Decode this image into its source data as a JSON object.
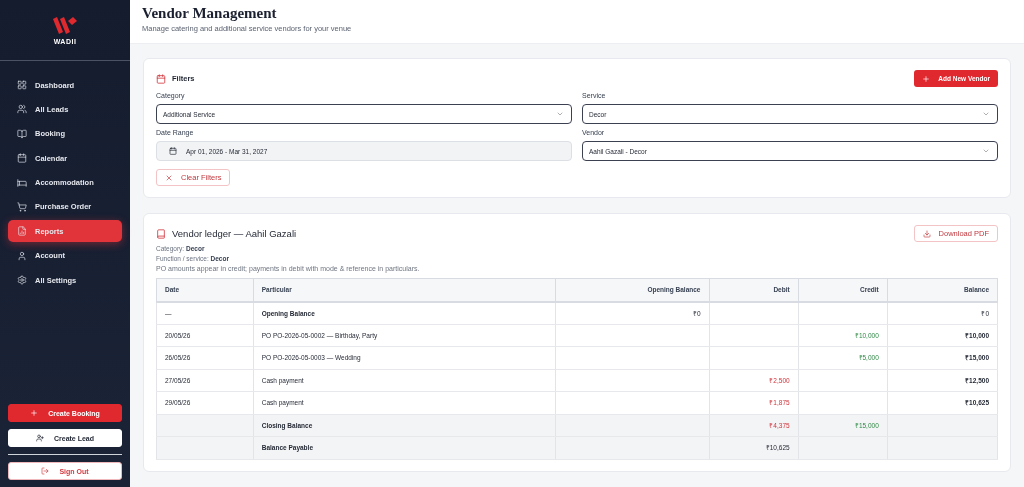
{
  "sidebar": {
    "brand": "WADII",
    "items": [
      {
        "label": "Dashboard",
        "selected": false
      },
      {
        "label": "All Leads",
        "selected": false
      },
      {
        "label": "Booking",
        "selected": false
      },
      {
        "label": "Calendar",
        "selected": false
      },
      {
        "label": "Accommodation",
        "selected": false
      },
      {
        "label": "Purchase Order",
        "selected": false
      },
      {
        "label": "Reports",
        "selected": true
      },
      {
        "label": "Account",
        "selected": false
      },
      {
        "label": "All Settings",
        "selected": false
      }
    ],
    "actions": [
      {
        "label": "Create Booking",
        "kind": "primary"
      },
      {
        "label": "Create Lead",
        "kind": "secondary"
      },
      {
        "label": "Sign Out",
        "kind": "danger"
      }
    ]
  },
  "header": {
    "title": "Vendor Management",
    "subtitle": "Manage catering and additional service vendors for your venue"
  },
  "filters": {
    "title": "Filters",
    "add_button": "Add New Vendor",
    "fields": [
      {
        "label": "Category",
        "value": "Additional Service",
        "kind": "select"
      },
      {
        "label": "Service",
        "value": "Decor",
        "kind": "select"
      },
      {
        "label": "Date Range",
        "value": "Apr 01, 2026 - Mar 31, 2027",
        "kind": "date"
      },
      {
        "label": "Vendor",
        "value": "Aahil Gazali - Decor",
        "kind": "select"
      }
    ],
    "clear_button": "Clear Filters"
  },
  "ledger": {
    "title": "Vendor ledger — Aahil Gazali",
    "download_button": "Download PDF",
    "meta": [
      "Category: **Decor**",
      "Function / service: **Decor**"
    ],
    "note": "PO amounts appear in credit; payments in debit with mode & reference in particulars.",
    "columns": [
      "Date",
      "Particular",
      "Opening Balance",
      "Debit",
      "Credit",
      "Balance"
    ],
    "rows": [
      {
        "kind": "opening",
        "date": "—",
        "particular": "Opening Balance",
        "opening": "₹0",
        "balance": "₹0"
      },
      {
        "kind": "entry",
        "date": "20/05/26",
        "particular": "PO PO-2026-05-0002 — Birthday, Party",
        "credit": "₹10,000",
        "balance": "₹10,000"
      },
      {
        "kind": "entry",
        "date": "26/05/26",
        "particular": "PO PO-2026-05-0003 — Wedding",
        "credit": "₹5,000",
        "balance": "₹15,000"
      },
      {
        "kind": "entry",
        "date": "27/05/26",
        "particular": "Cash payment",
        "debit": "₹2,500",
        "balance": "₹12,500"
      },
      {
        "kind": "entry",
        "date": "29/05/26",
        "particular": "Cash payment",
        "debit": "₹1,875",
        "balance": "₹10,625"
      },
      {
        "kind": "closing",
        "particular": "Closing Balance",
        "debit": "₹4,375",
        "credit": "₹15,000"
      },
      {
        "kind": "payable",
        "particular": "Balance Payable",
        "debit": "₹10,625"
      }
    ]
  }
}
